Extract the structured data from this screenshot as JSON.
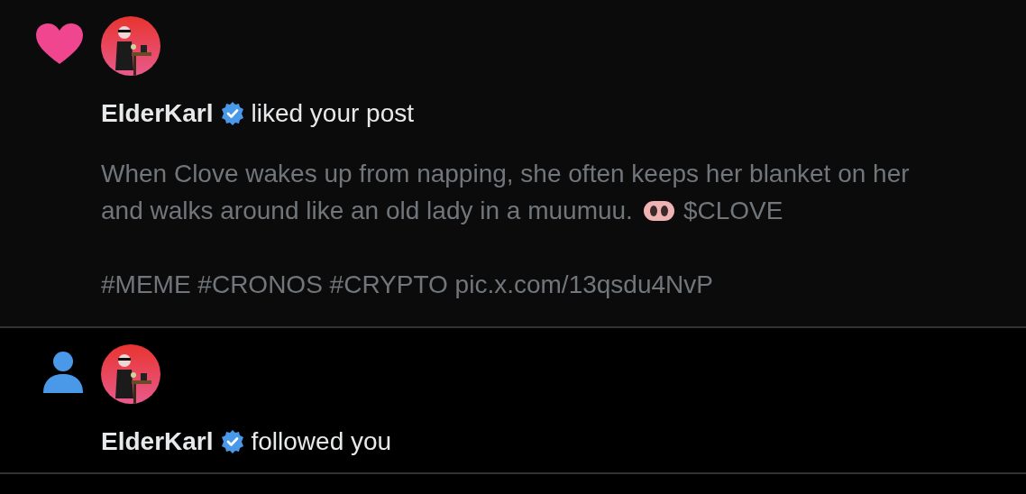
{
  "notifications": [
    {
      "kind": "like",
      "user": {
        "name": "ElderKarl",
        "verified": true
      },
      "action": "liked your post",
      "post": {
        "line_1": "When Clove wakes up from napping, she often keeps her blanket on her",
        "line_2": "and walks around like an old lady in a muumuu.",
        "text_after": "$CLOVE",
        "tags": "#MEME #CRONOS #CRYPTO pic.x.com/13qsdu4NvP"
      }
    },
    {
      "kind": "follow",
      "user": {
        "name": "ElderKarl",
        "verified": true
      },
      "action": "followed you"
    }
  ]
}
